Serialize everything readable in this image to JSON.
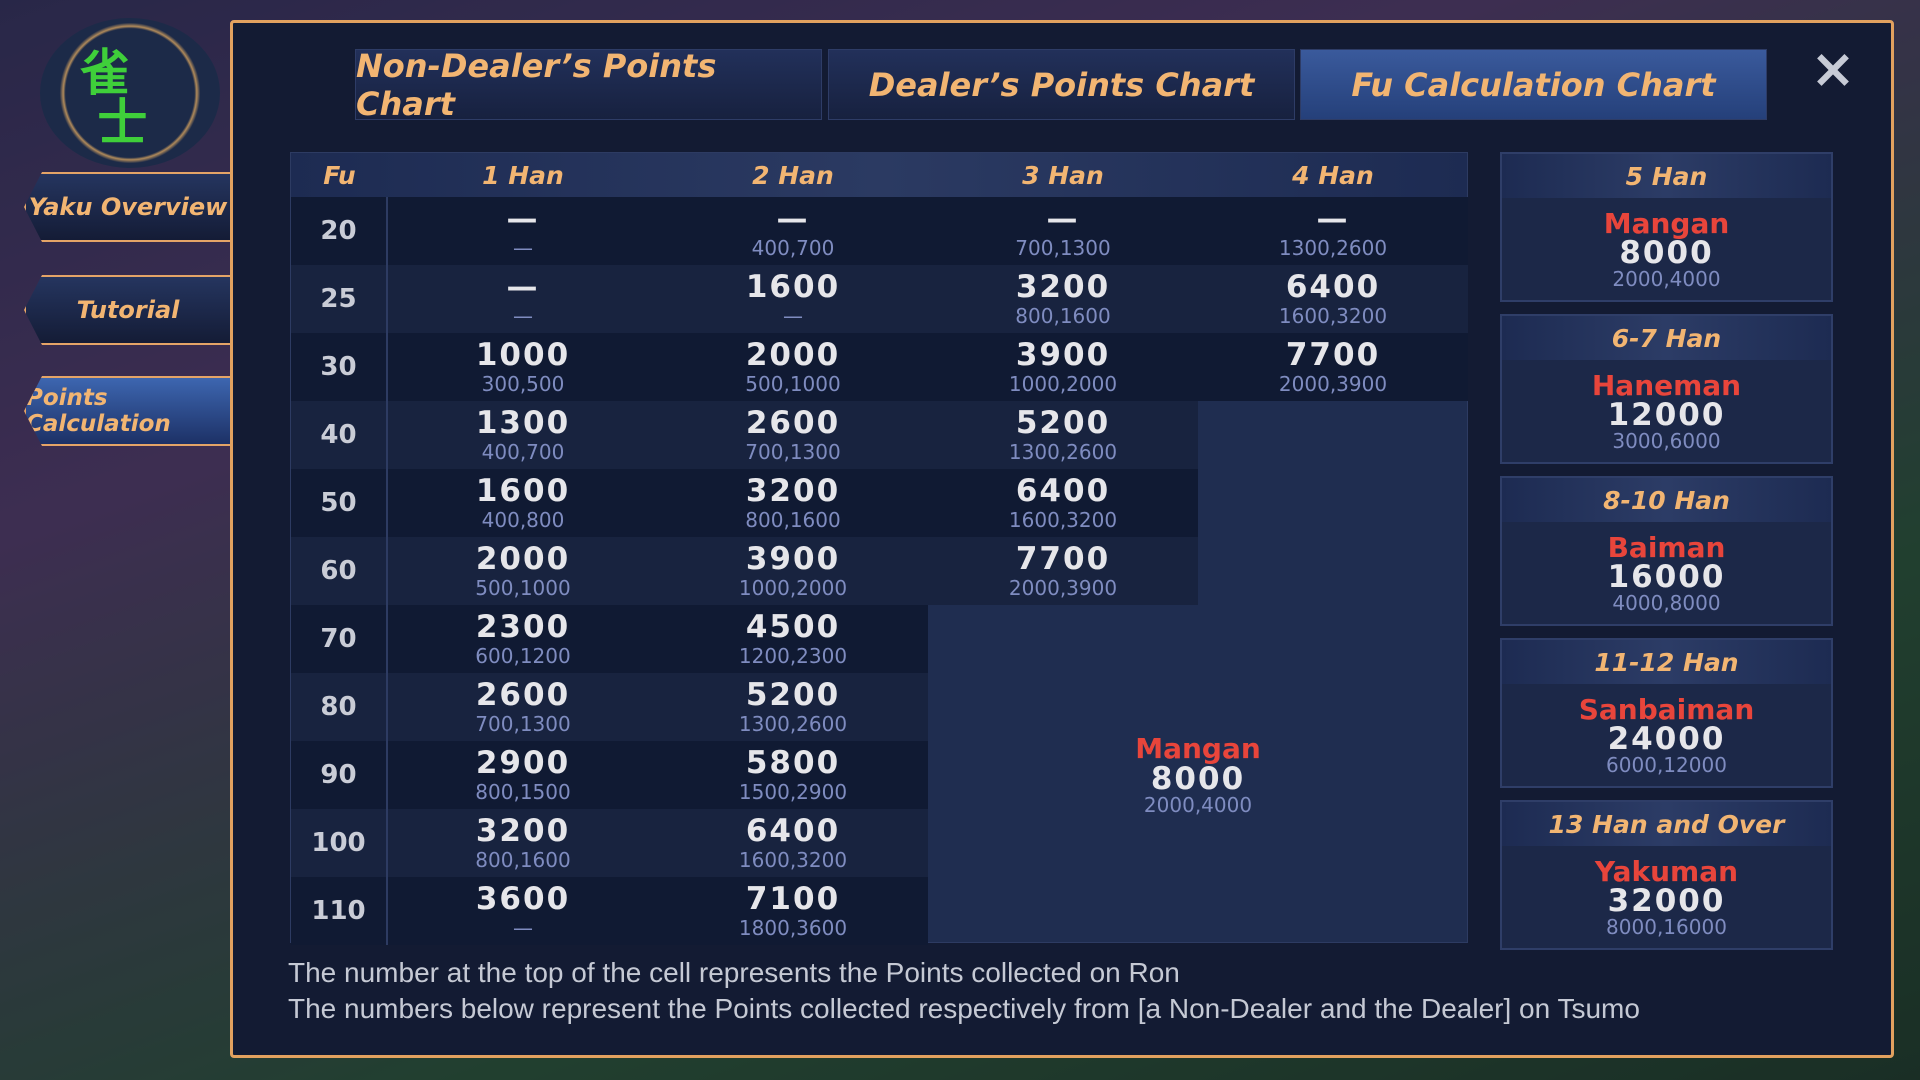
{
  "sidebar": {
    "items": [
      {
        "label": "Yaku Overview"
      },
      {
        "label": "Tutorial"
      },
      {
        "label": "Points Calculation",
        "active": true
      }
    ]
  },
  "logo_text": "雀士",
  "tabs": [
    {
      "label": "Non-Dealer’s Points Chart"
    },
    {
      "label": "Dealer’s Points Chart"
    },
    {
      "label": "Fu Calculation Chart",
      "active": true
    }
  ],
  "close_icon": "×",
  "table": {
    "headers": [
      "Fu",
      "1 Han",
      "2 Han",
      "3 Han",
      "4 Han"
    ],
    "rows": [
      {
        "fu": "20",
        "cells": [
          [
            "—",
            "—"
          ],
          [
            "—",
            "400,700"
          ],
          [
            "—",
            "700,1300"
          ],
          [
            "—",
            "1300,2600"
          ]
        ]
      },
      {
        "fu": "25",
        "cells": [
          [
            "—",
            "—"
          ],
          [
            "1600",
            "—"
          ],
          [
            "3200",
            "800,1600"
          ],
          [
            "6400",
            "1600,3200"
          ]
        ]
      },
      {
        "fu": "30",
        "cells": [
          [
            "1000",
            "300,500"
          ],
          [
            "2000",
            "500,1000"
          ],
          [
            "3900",
            "1000,2000"
          ],
          [
            "7700",
            "2000,3900"
          ]
        ]
      },
      {
        "fu": "40",
        "cells": [
          [
            "1300",
            "400,700"
          ],
          [
            "2600",
            "700,1300"
          ],
          [
            "5200",
            "1300,2600"
          ]
        ]
      },
      {
        "fu": "50",
        "cells": [
          [
            "1600",
            "400,800"
          ],
          [
            "3200",
            "800,1600"
          ],
          [
            "6400",
            "1600,3200"
          ]
        ]
      },
      {
        "fu": "60",
        "cells": [
          [
            "2000",
            "500,1000"
          ],
          [
            "3900",
            "1000,2000"
          ],
          [
            "7700",
            "2000,3900"
          ]
        ]
      },
      {
        "fu": "70",
        "cells": [
          [
            "2300",
            "600,1200"
          ],
          [
            "4500",
            "1200,2300"
          ]
        ]
      },
      {
        "fu": "80",
        "cells": [
          [
            "2600",
            "700,1300"
          ],
          [
            "5200",
            "1300,2600"
          ]
        ]
      },
      {
        "fu": "90",
        "cells": [
          [
            "2900",
            "800,1500"
          ],
          [
            "5800",
            "1500,2900"
          ]
        ]
      },
      {
        "fu": "100",
        "cells": [
          [
            "3200",
            "800,1600"
          ],
          [
            "6400",
            "1600,3200"
          ]
        ]
      },
      {
        "fu": "110",
        "cells": [
          [
            "3600",
            "—"
          ],
          [
            "7100",
            "1800,3600"
          ]
        ]
      }
    ],
    "mangan": {
      "name": "Mangan",
      "ron": "8000",
      "tsumo": "2000,4000"
    }
  },
  "limits": [
    {
      "han": "5 Han",
      "name": "Mangan",
      "ron": "8000",
      "tsumo": "2000,4000"
    },
    {
      "han": "6-7 Han",
      "name": "Haneman",
      "ron": "12000",
      "tsumo": "3000,6000"
    },
    {
      "han": "8-10 Han",
      "name": "Baiman",
      "ron": "16000",
      "tsumo": "4000,8000"
    },
    {
      "han": "11-12 Han",
      "name": "Sanbaiman",
      "ron": "24000",
      "tsumo": "6000,12000"
    },
    {
      "han": "13 Han and Over",
      "name": "Yakuman",
      "ron": "32000",
      "tsumo": "8000,16000"
    }
  ],
  "footer": {
    "line1": "The number at the top of the cell represents the Points collected on Ron",
    "line2": "The numbers below represent the Points collected respectively from [a Non-Dealer and the Dealer] on Tsumo"
  }
}
